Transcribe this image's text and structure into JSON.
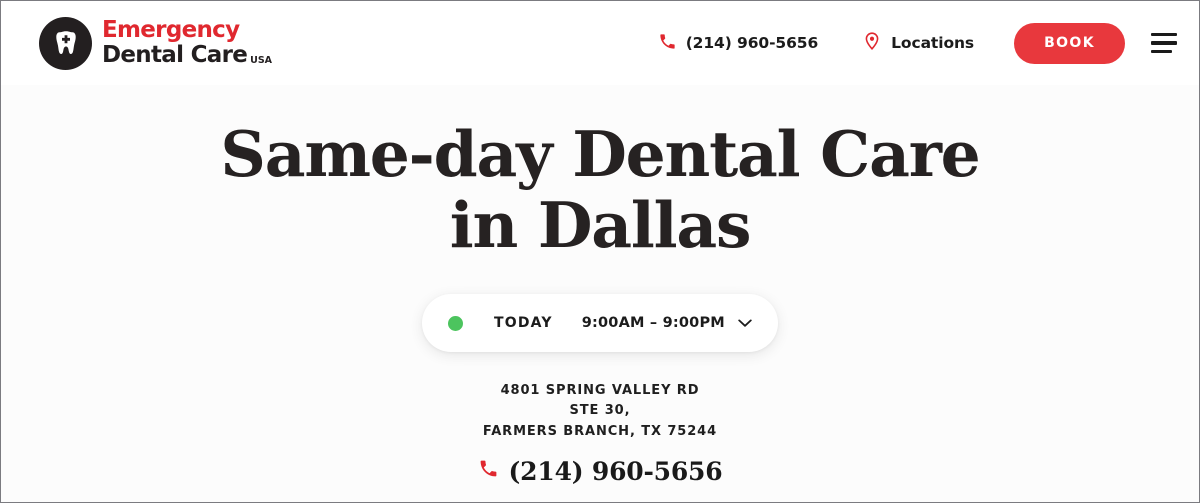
{
  "colors": {
    "brand_red": "#E8383D",
    "logo_red": "#E0282F",
    "ink": "#1C1C1C",
    "headline": "#262222",
    "status_green": "#4CC45E",
    "page_bg": "#FCFCFC"
  },
  "header": {
    "logo": {
      "icon": "tooth-cross-icon",
      "line1": "Emergency",
      "line2": "Dental Care",
      "suffix": "USA"
    },
    "phone": {
      "icon": "phone-icon",
      "label": "(214) 960-5656"
    },
    "locations": {
      "icon": "map-pin-icon",
      "label": "Locations"
    },
    "book_label": "BOOK",
    "menu_icon": "hamburger-menu-icon"
  },
  "hero": {
    "headline_line1": "Same-day Dental Care",
    "headline_line2": "in Dallas",
    "hours": {
      "status_icon": "status-dot-open",
      "day_label": "TODAY",
      "range": "9:00AM – 9:00PM",
      "chevron_icon": "chevron-down-icon"
    },
    "address": [
      "4801 SPRING VALLEY RD",
      "STE 30,",
      "FARMERS BRANCH, TX 75244"
    ],
    "phone": {
      "icon": "phone-icon",
      "label": "(214) 960-5656"
    }
  }
}
